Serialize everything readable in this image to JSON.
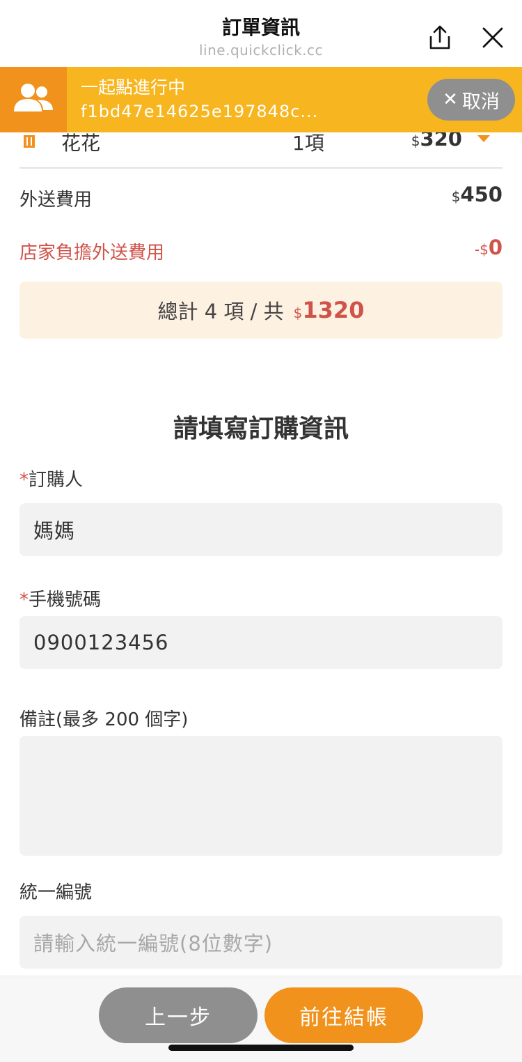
{
  "header": {
    "title": "訂單資訊",
    "url": "line.quickclick.cc",
    "share_icon": "share-icon",
    "close_icon": "close-icon"
  },
  "banner": {
    "status": "一起點進行中",
    "code": "f1bd47e14625e197848c...",
    "cancel_label": "取消",
    "avatar_icon": "group-users-icon",
    "colors": {
      "background": "#f7b51f",
      "avatar_bg": "#f0921b",
      "cancel_bg": "#8f8f8f"
    }
  },
  "order": {
    "item": {
      "name": "花花",
      "qty": "1項",
      "currency": "$",
      "price": "320"
    },
    "delivery": {
      "label": "外送費用",
      "currency": "$",
      "value": "450"
    },
    "store_discount": {
      "label": "店家負擔外送費用",
      "prefix": "-",
      "currency": "$",
      "value": "0"
    },
    "total": {
      "text": "總計 4 項 / 共",
      "currency": "$",
      "value": "1320"
    }
  },
  "form": {
    "title": "請填寫訂購資訊",
    "required_mark": "*",
    "buyer": {
      "label": "訂購人",
      "value": "媽媽"
    },
    "phone": {
      "label": "手機號碼",
      "value": "0900123456"
    },
    "note": {
      "label": "備註(最多 200 個字)",
      "value": ""
    },
    "tax_id": {
      "label": "統一編號",
      "placeholder": "請輸入統一編號(8位數字)"
    }
  },
  "footer": {
    "back_label": "上一步",
    "checkout_label": "前往結帳",
    "colors": {
      "back": "#8f8f8f",
      "checkout": "#f0921b"
    }
  },
  "colors": {
    "accent": "#f0921b",
    "discount_red": "#d0534a",
    "total_bg": "#fdf1e2",
    "field_bg": "#f2f2f2"
  }
}
